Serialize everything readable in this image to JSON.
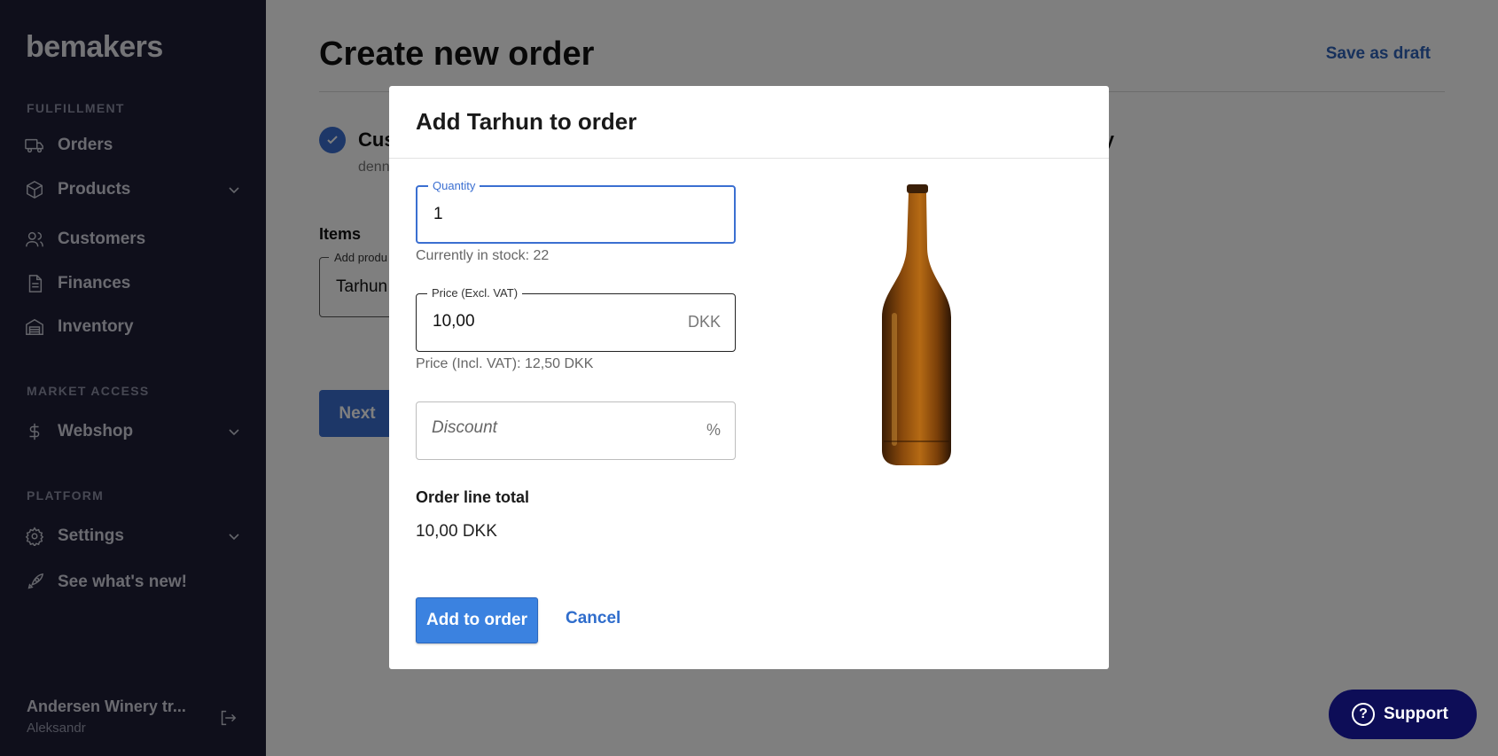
{
  "sidebar": {
    "logo": "bemakers",
    "sections": {
      "fulfillment": "FULFILLMENT",
      "market_access": "MARKET ACCESS",
      "platform": "PLATFORM"
    },
    "items": {
      "orders": "Orders",
      "products": "Products",
      "customers": "Customers",
      "finances": "Finances",
      "inventory": "Inventory",
      "webshop": "Webshop",
      "settings": "Settings",
      "whats_new": "See what's new!"
    },
    "user": {
      "name": "Andersen Winery tr...",
      "sub": "Aleksandr"
    }
  },
  "main": {
    "title": "Create new order",
    "save_draft": "Save as draft",
    "step_label": "Cus",
    "step_sub": "denn",
    "step_label_right": "ary",
    "items_label": "Items",
    "add_product_legend": "Add produ",
    "add_product_value": "Tarhun",
    "next": "Next"
  },
  "modal": {
    "title": "Add Tarhun to order",
    "quantity": {
      "label": "Quantity",
      "value": "1",
      "helper": "Currently in stock: 22"
    },
    "price": {
      "label": "Price (Excl. VAT)",
      "value": "10,00",
      "suffix": "DKK",
      "helper": "Price (Incl. VAT): 12,50 DKK"
    },
    "discount": {
      "placeholder": "Discount",
      "suffix": "%"
    },
    "total_label": "Order line total",
    "total_value": "10,00 DKK",
    "add_button": "Add to order",
    "cancel_button": "Cancel"
  },
  "support": {
    "label": "Support"
  },
  "colors": {
    "sidebar_bg": "#1e1f36",
    "accent": "#3b6fd1",
    "support_bg": "#0d0d57"
  }
}
